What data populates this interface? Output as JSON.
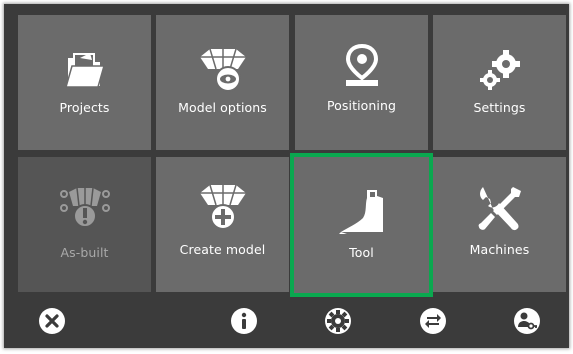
{
  "tiles": [
    {
      "label": "Projects",
      "icon": "folder-icon"
    },
    {
      "label": "Model options",
      "icon": "model-eye-icon"
    },
    {
      "label": "Positioning",
      "icon": "location-pin-icon"
    },
    {
      "label": "Settings",
      "icon": "gears-icon"
    },
    {
      "label": "As-built",
      "icon": "as-built-icon",
      "state": "disabled"
    },
    {
      "label": "Create model",
      "icon": "model-add-icon"
    },
    {
      "label": "Tool",
      "icon": "bucket-icon",
      "state": "selected"
    },
    {
      "label": "Machines",
      "icon": "wrench-screwdriver-icon"
    }
  ],
  "bottom_bar": [
    {
      "icon": "close-icon"
    },
    {
      "icon": "info-icon"
    },
    {
      "icon": "gear-settings-icon"
    },
    {
      "icon": "swap-icon"
    },
    {
      "icon": "user-key-icon"
    }
  ],
  "colors": {
    "background": "#3b3b3b",
    "tile": "#6b6b6b",
    "tile_disabled": "#555555",
    "selection": "#0aa84f",
    "icon": "#ffffff"
  }
}
